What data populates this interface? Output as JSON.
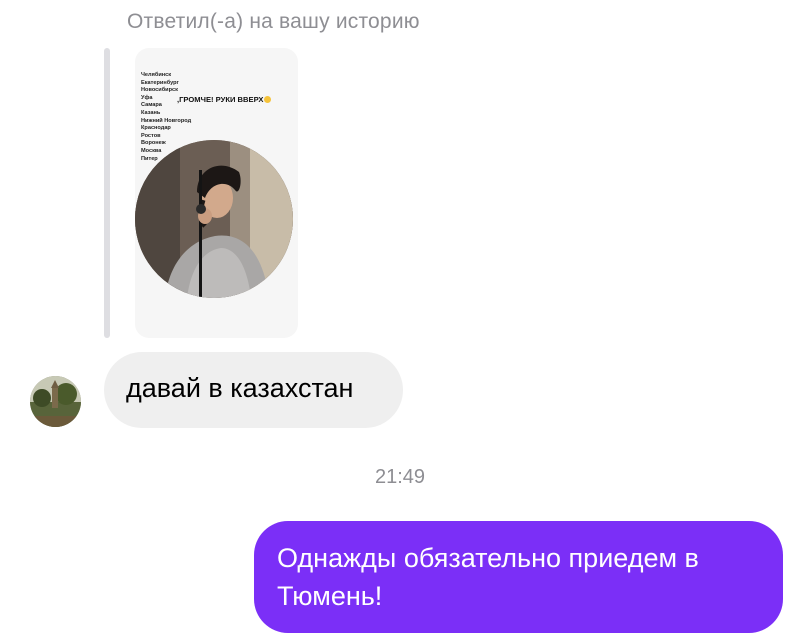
{
  "reply_header": "Ответил(-а) на вашу историю",
  "story": {
    "cities": [
      "Челябинск",
      "Екатеринбург",
      "Новосибирск",
      "Уфа",
      "Самара",
      "Казань",
      "Нижний Новгород",
      "Краснодар",
      "Ростов",
      "Воронеж",
      "Москва",
      "Питер"
    ],
    "caption": ",ГРОМЧЕ! РУКИ ВВЕРХ"
  },
  "messages": {
    "incoming_text": "давай в казахстан",
    "timestamp": "21:49",
    "outgoing_text": "Однажды обязательно приедем в Тюмень!"
  },
  "colors": {
    "outgoing_bubble": "#7b2ff7",
    "incoming_bubble": "#efefef",
    "meta_text": "#8e8e93"
  }
}
